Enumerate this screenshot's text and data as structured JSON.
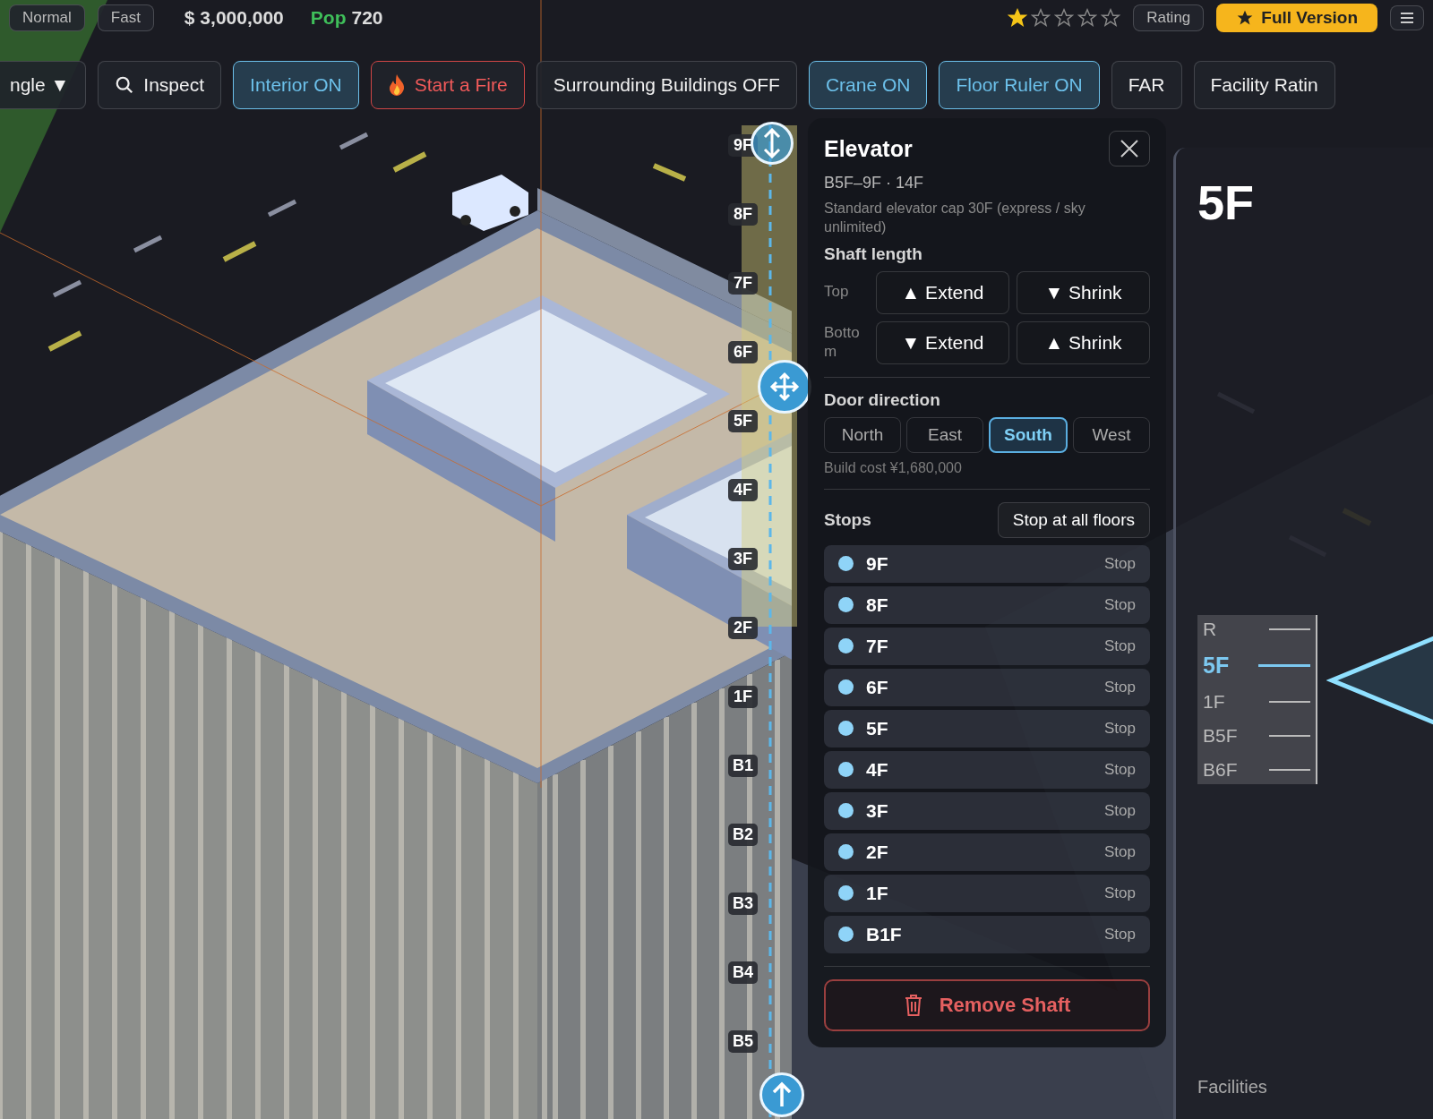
{
  "top_bar": {
    "speed_buttons": [
      {
        "label": "Normal",
        "selected": false
      },
      {
        "label": "Fast",
        "selected": false
      }
    ],
    "money": "$ 3,000,000",
    "population": {
      "label": "Pop",
      "value": "720"
    },
    "stars": 1,
    "rating_button": "Rating",
    "upgrade_button": "Full Version"
  },
  "toolbar": [
    {
      "label": "ngle ▼",
      "kind": "dropdown"
    },
    {
      "label": "Inspect",
      "kind": "inspect"
    },
    {
      "label": "Interior ON",
      "kind": "toggle",
      "on": true
    },
    {
      "label": "Start a Fire",
      "kind": "hazard"
    },
    {
      "label": "Surrounding Buildings OFF",
      "kind": "toggle",
      "on": false
    },
    {
      "label": "Crane ON",
      "kind": "toggle",
      "on": true
    },
    {
      "label": "Floor Ruler ON",
      "kind": "toggle",
      "on": true
    },
    {
      "label": "FAR",
      "kind": "plain"
    },
    {
      "label": "Facility Ratin",
      "kind": "plain"
    }
  ],
  "floor_markers": [
    "9F",
    "8F",
    "7F",
    "6F",
    "5F",
    "4F",
    "3F",
    "2F",
    "1F",
    "B1",
    "B2",
    "B3",
    "B4",
    "B5"
  ],
  "elevator_panel": {
    "title": "Elevator",
    "range": "B5F–9F · 14F",
    "note": "Standard elevator cap 30F (express / sky unlimited)",
    "shaft_length": {
      "title": "Shaft length",
      "rows": [
        {
          "label": "Top",
          "buttons": [
            "▲ Extend",
            "▼ Shrink"
          ]
        },
        {
          "label": "Bottom",
          "buttons": [
            "▼ Extend",
            "▲ Shrink"
          ]
        }
      ]
    },
    "door_direction": {
      "title": "Door direction",
      "options": [
        {
          "label": "North",
          "selected": false
        },
        {
          "label": "East",
          "selected": false
        },
        {
          "label": "South",
          "selected": true
        },
        {
          "label": "West",
          "selected": false
        }
      ]
    },
    "build_cost": "Build cost ¥1,680,000",
    "stops": {
      "title": "Stops",
      "all_button": "Stop at all floors",
      "items": [
        {
          "floor": "9F",
          "action": "Stop",
          "on": true
        },
        {
          "floor": "8F",
          "action": "Stop",
          "on": true
        },
        {
          "floor": "7F",
          "action": "Stop",
          "on": true
        },
        {
          "floor": "6F",
          "action": "Stop",
          "on": true
        },
        {
          "floor": "5F",
          "action": "Stop",
          "on": true
        },
        {
          "floor": "4F",
          "action": "Stop",
          "on": true
        },
        {
          "floor": "3F",
          "action": "Stop",
          "on": true
        },
        {
          "floor": "2F",
          "action": "Stop",
          "on": true
        },
        {
          "floor": "1F",
          "action": "Stop",
          "on": true
        },
        {
          "floor": "B1F",
          "action": "Stop",
          "on": true
        }
      ]
    },
    "remove_button": "Remove Shaft"
  },
  "floor_view": {
    "title": "5F",
    "ruler": [
      {
        "label": "R",
        "selected": false
      },
      {
        "label": "5F",
        "selected": true
      },
      {
        "label": "1F",
        "selected": false
      },
      {
        "label": "B5F",
        "selected": false
      },
      {
        "label": "B6F",
        "selected": false
      }
    ],
    "facilities_heading": "Facilities"
  }
}
